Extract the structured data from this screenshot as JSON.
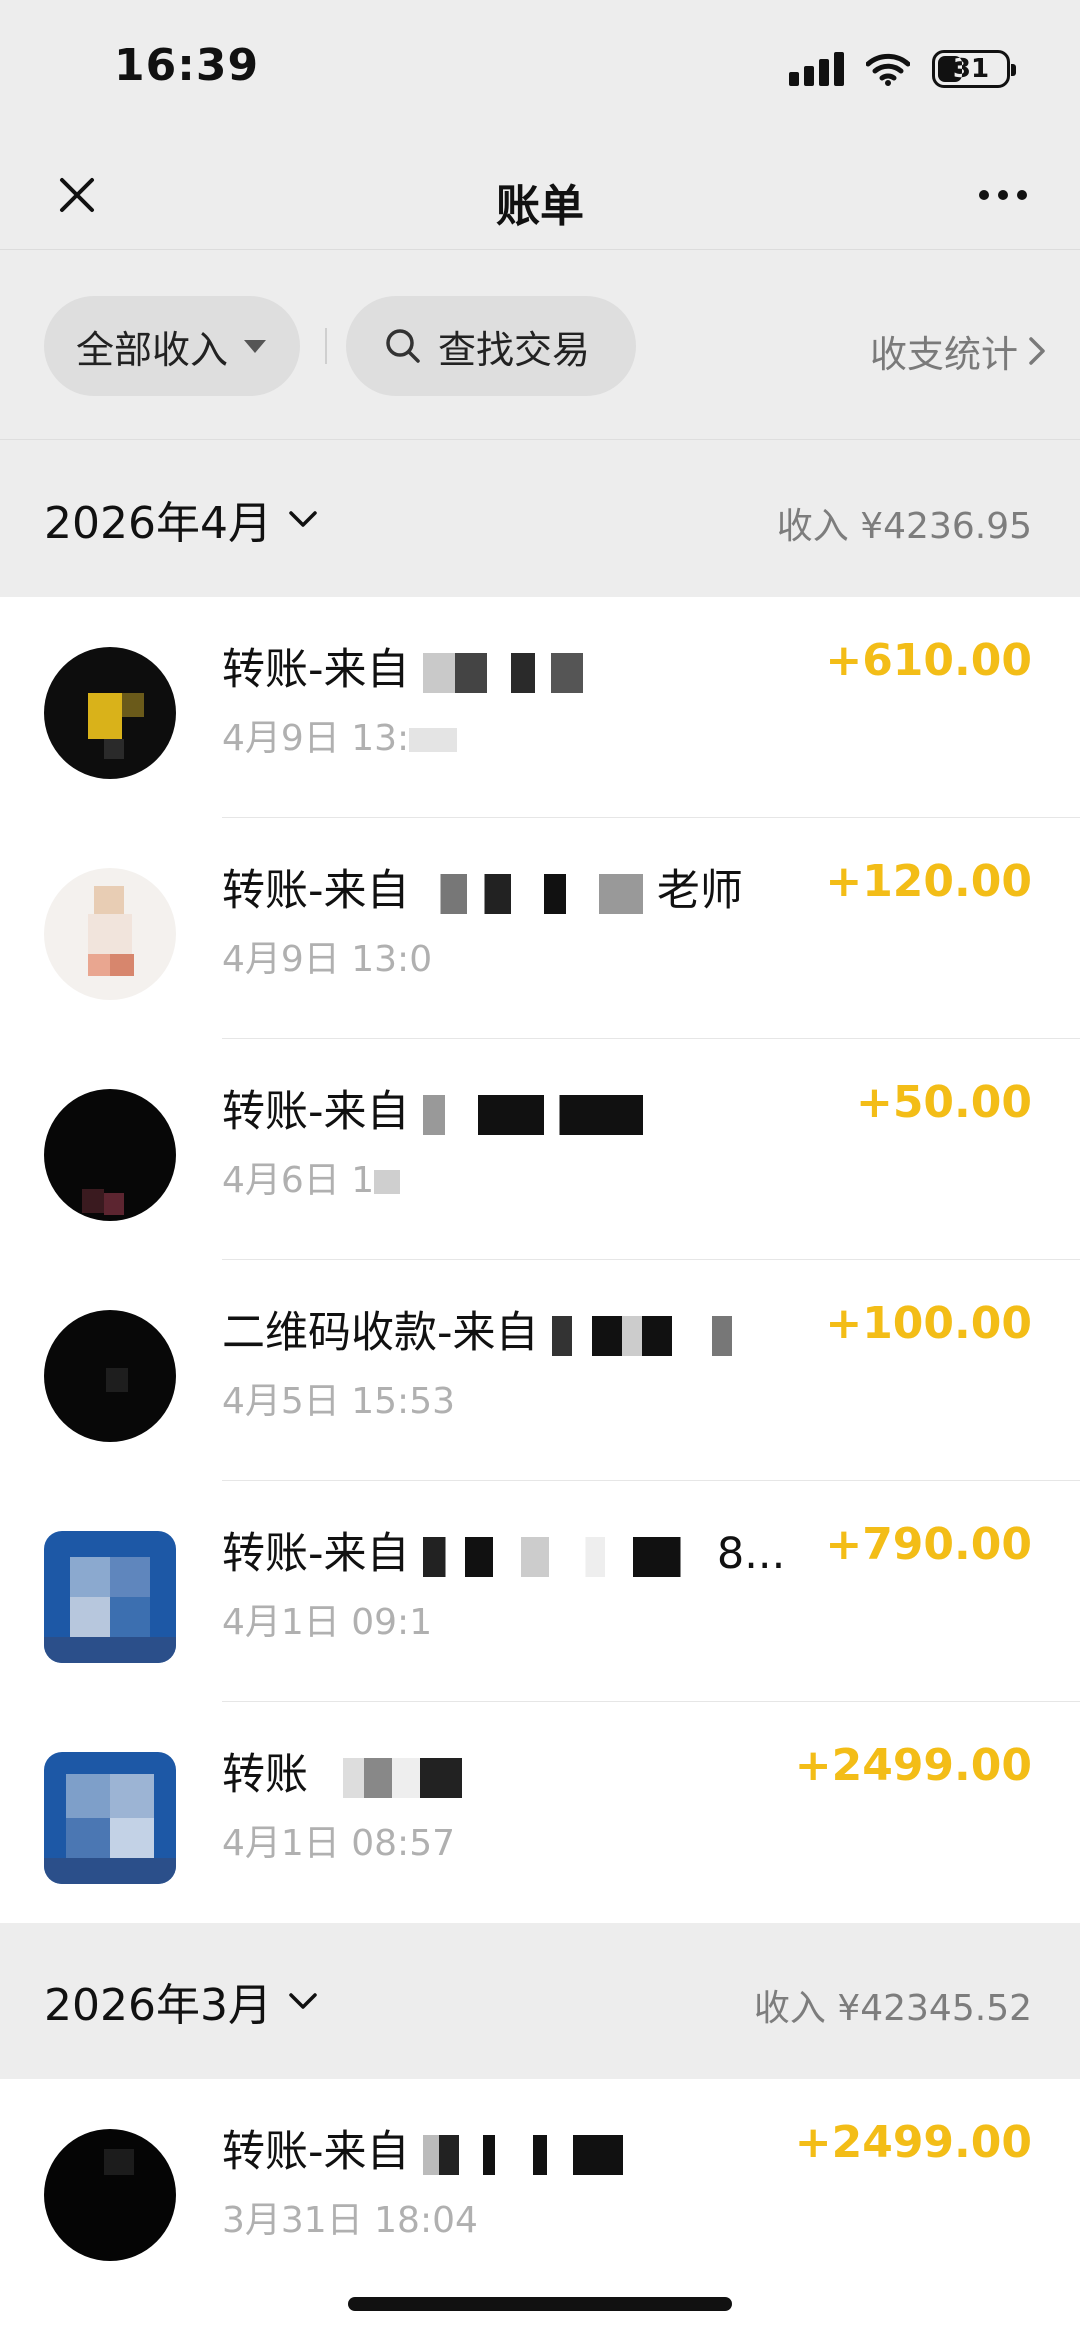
{
  "status": {
    "time": "16:39",
    "battery": "31"
  },
  "nav": {
    "title": "账单"
  },
  "filters": {
    "filter_label": "全部收入",
    "search_label": "查找交易",
    "stats_label": "收支统计"
  },
  "months": [
    {
      "label": "2026年4月",
      "summary": "收入 ¥4236.95",
      "rows": [
        {
          "title": "转账-来自",
          "time": "4月9日 13:",
          "amount": "+610.00",
          "avatar": "dark-yellow"
        },
        {
          "title": "转账-来自",
          "title_suffix": "老师",
          "time": "4月9日 13:0",
          "amount": "+120.00",
          "avatar": "light"
        },
        {
          "title": "转账-来自",
          "time": "4月6日 1",
          "amount": "+50.00",
          "avatar": "dark"
        },
        {
          "title": "二维码收款-来自",
          "time": "4月5日 15:53",
          "amount": "+100.00",
          "avatar": "dark"
        },
        {
          "title": "转账-来自",
          "title_suffix": "8...",
          "time": "4月1日 09:1",
          "amount": "+790.00",
          "avatar": "blue"
        },
        {
          "title": "转账",
          "time": "4月1日 08:57",
          "amount": "+2499.00",
          "avatar": "blue"
        }
      ]
    },
    {
      "label": "2026年3月",
      "summary": "收入 ¥42345.52",
      "rows": [
        {
          "title": "转账-来自",
          "time": "3月31日 18:04",
          "amount": "+2499.00",
          "avatar": "dark"
        }
      ]
    }
  ],
  "colors": {
    "amount": "#f3bd17",
    "background": "#ededed",
    "list_bg": "#ffffff"
  }
}
